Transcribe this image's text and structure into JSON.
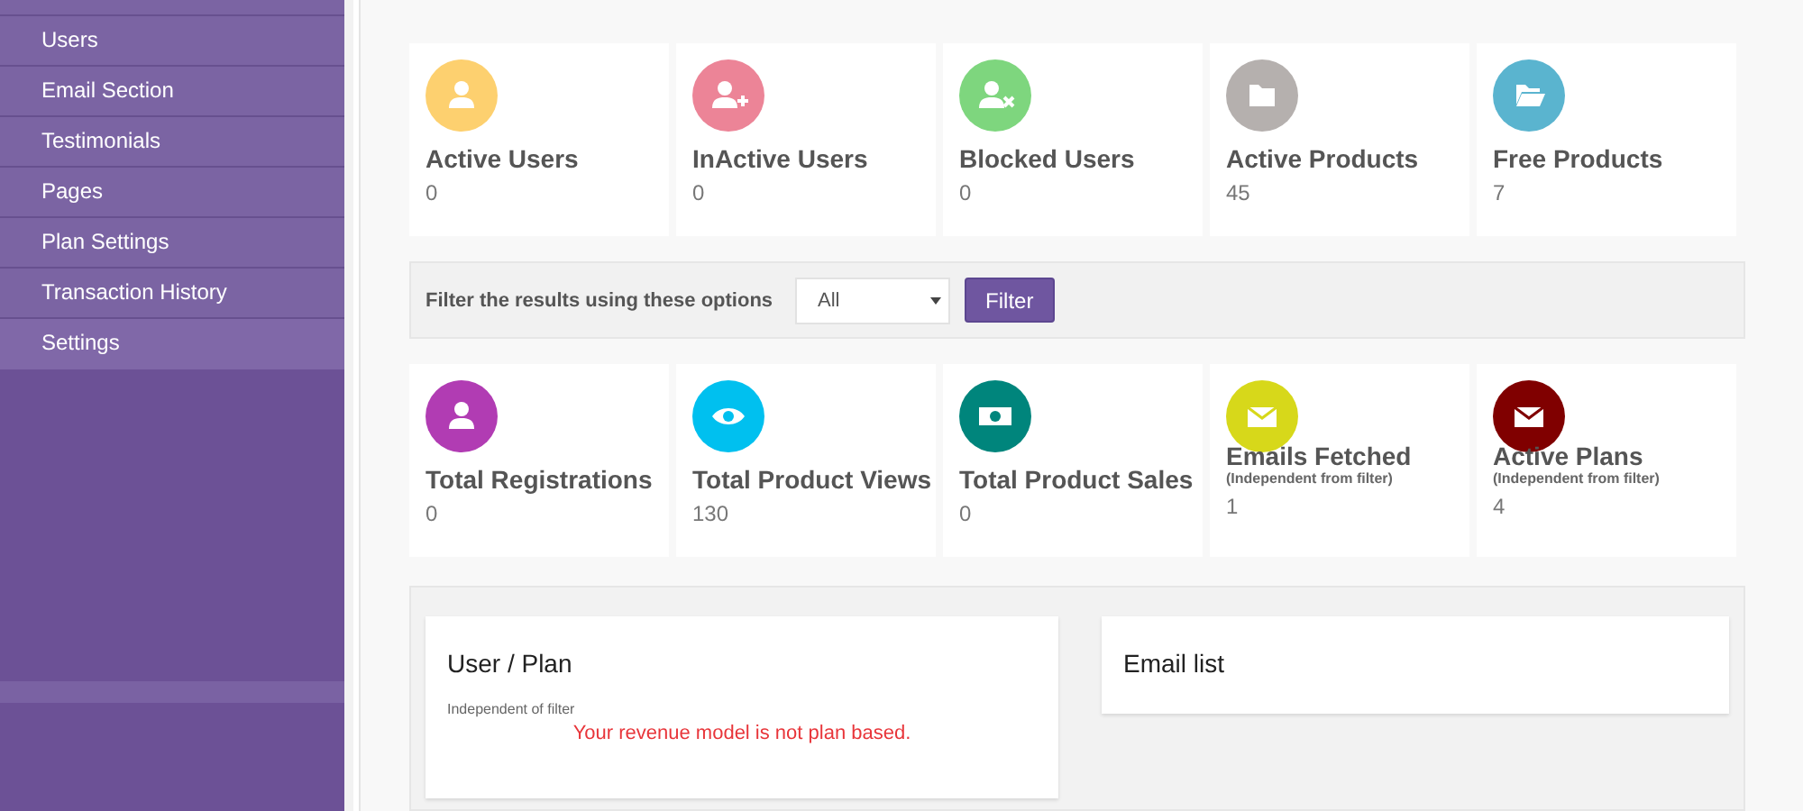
{
  "sidebar": {
    "items": [
      {
        "label": "Users",
        "selected": false
      },
      {
        "label": "Email Section",
        "selected": false
      },
      {
        "label": "Testimonials",
        "selected": false
      },
      {
        "label": "Pages",
        "selected": false
      },
      {
        "label": "Plan Settings",
        "selected": false
      },
      {
        "label": "Transaction History",
        "selected": false
      },
      {
        "label": "Settings",
        "selected": true
      }
    ]
  },
  "top_stats": [
    {
      "kind": "user",
      "color": "#fdd06f",
      "title": "Active Users",
      "value": "0"
    },
    {
      "kind": "user-plus",
      "color": "#ec8497",
      "title": "InActive Users",
      "value": "0"
    },
    {
      "kind": "user-x",
      "color": "#7ed67e",
      "title": "Blocked Users",
      "value": "0"
    },
    {
      "kind": "folder",
      "color": "#b5b0ae",
      "title": "Active Products",
      "value": "45"
    },
    {
      "kind": "folder-open",
      "color": "#5ab4cf",
      "title": "Free Products",
      "value": "7"
    }
  ],
  "filter": {
    "label": "Filter the results using these options",
    "select_value": "All",
    "button": "Filter"
  },
  "stats": [
    {
      "kind": "user",
      "color": "#b13cb3",
      "title": "Total Registrations",
      "value": "0"
    },
    {
      "kind": "eye",
      "color": "#00c0ef",
      "title": "Total Product Views",
      "value": "130"
    },
    {
      "kind": "money",
      "color": "#00857c",
      "title": "Total Product Sales",
      "value": "0"
    },
    {
      "kind": "mail",
      "color": "#d7d81a",
      "title": "Emails Fetched",
      "note": "(Independent from filter)",
      "value": "1"
    },
    {
      "kind": "mail",
      "color": "#800000",
      "title": "Active Plans",
      "note": "(Independent from filter)",
      "value": "4"
    }
  ],
  "user_plan_panel": {
    "title": "User / Plan",
    "note": "Independent of filter",
    "message": "Your revenue model is not plan based."
  },
  "email_panel": {
    "title": "Email list"
  }
}
